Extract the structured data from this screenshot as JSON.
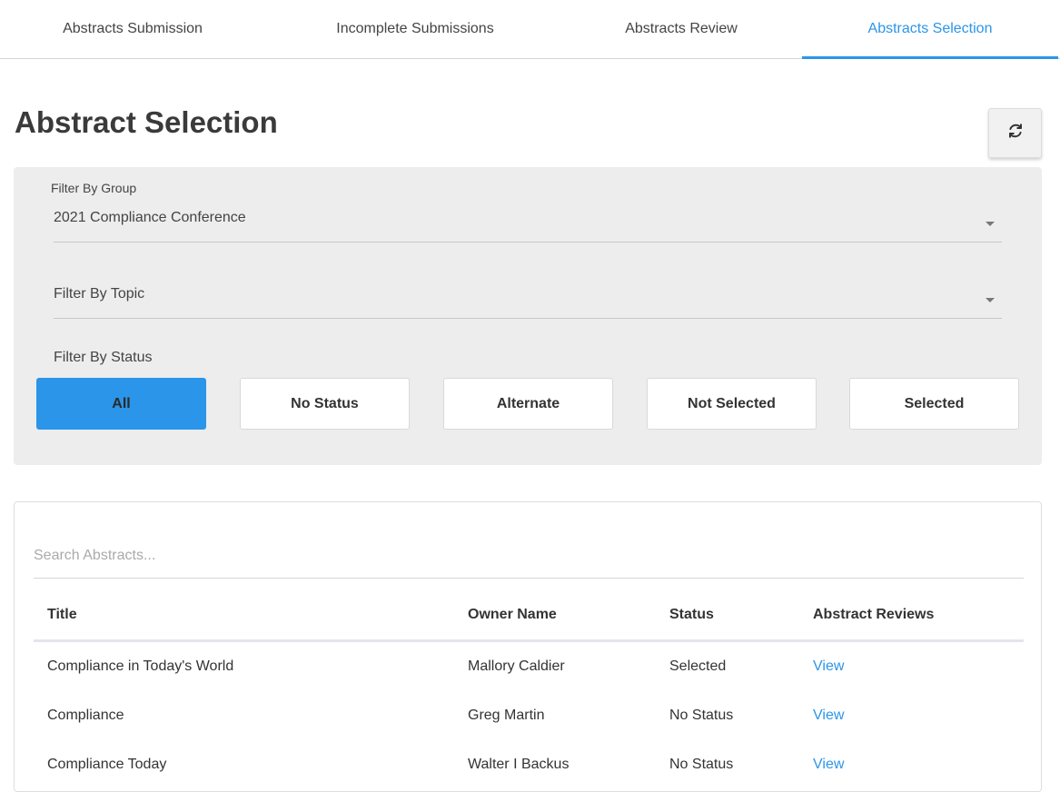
{
  "tabs": [
    {
      "label": "Abstracts Submission"
    },
    {
      "label": "Incomplete Submissions"
    },
    {
      "label": "Abstracts Review"
    },
    {
      "label": "Abstracts Selection"
    }
  ],
  "page": {
    "title": "Abstract Selection",
    "refresh_icon": "refresh-icon"
  },
  "filters": {
    "group": {
      "label": "Filter By Group",
      "value": "2021 Compliance Conference"
    },
    "topic": {
      "label": "Filter By Topic",
      "value": ""
    },
    "status": {
      "label": "Filter By Status",
      "options": [
        "All",
        "No Status",
        "Alternate",
        "Not Selected",
        "Selected"
      ],
      "selected": "All"
    }
  },
  "table": {
    "search_placeholder": "Search Abstracts...",
    "columns": [
      "Title",
      "Owner Name",
      "Status",
      "Abstract Reviews"
    ],
    "rows": [
      {
        "title": "Compliance in Today's World",
        "owner": "Mallory Caldier",
        "status": "Selected",
        "reviews": "View"
      },
      {
        "title": "Compliance",
        "owner": "Greg Martin",
        "status": "No Status",
        "reviews": "View"
      },
      {
        "title": "Compliance Today",
        "owner": "Walter I Backus",
        "status": "No Status",
        "reviews": "View"
      }
    ]
  },
  "colors": {
    "accent": "#2b95e9",
    "panel_bg": "#ededed"
  }
}
